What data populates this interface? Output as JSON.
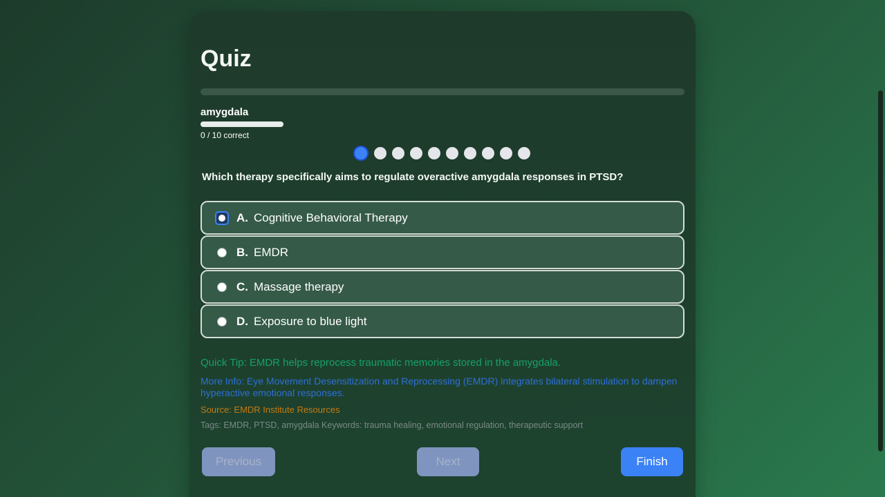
{
  "quiz": {
    "title": "Quiz",
    "overall_progress": 0,
    "topic": {
      "name": "amygdala",
      "progress": 0,
      "score_text": "0 / 10 correct"
    },
    "question_count": 10,
    "current_index": 0,
    "question": "Which therapy specifically aims to regulate overactive amygdala responses in PTSD?",
    "options": [
      {
        "letter": "A.",
        "text": "Cognitive Behavioral Therapy"
      },
      {
        "letter": "B.",
        "text": "EMDR"
      },
      {
        "letter": "C.",
        "text": "Massage therapy"
      },
      {
        "letter": "D.",
        "text": "Exposure to blue light"
      }
    ],
    "tip": "Quick Tip: EMDR helps reprocess traumatic memories stored in the amygdala.",
    "more_info": "More Info: Eye Movement Desensitization and Reprocessing (EMDR) integrates bilateral stimulation to dampen hyperactive emotional responses.",
    "source": "Source: EMDR Institute Resources",
    "tags": "Tags: EMDR, PTSD, amygdala Keywords: trauma healing, emotional regulation, therapeutic support"
  },
  "buttons": {
    "previous": "Previous",
    "next": "Next",
    "finish": "Finish"
  },
  "colors": {
    "accent": "#3b82f6",
    "tip": "#16a06a",
    "info": "#2f6fd8",
    "source": "#c77a10"
  }
}
